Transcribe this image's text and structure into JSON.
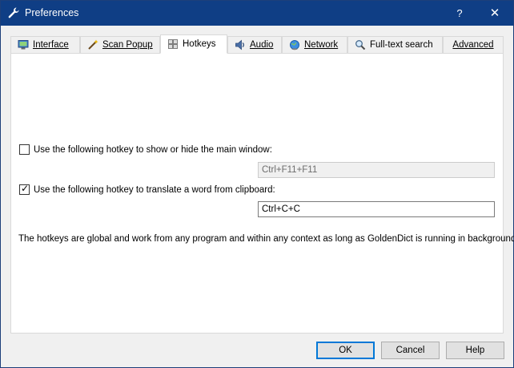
{
  "window": {
    "title": "Preferences",
    "help_symbol": "?",
    "close_symbol": "✕"
  },
  "tabs": [
    {
      "label": "Interface",
      "icon": "monitor-icon",
      "active": false
    },
    {
      "label": "Scan Popup",
      "icon": "wand-icon",
      "active": false
    },
    {
      "label": "Hotkeys",
      "icon": "keyboard-icon",
      "active": true
    },
    {
      "label": "Audio",
      "icon": "speaker-icon",
      "active": false
    },
    {
      "label": "Network",
      "icon": "globe-icon",
      "active": false
    },
    {
      "label": "Full-text search",
      "icon": "magnifier-icon",
      "active": false
    },
    {
      "label": "Advanced",
      "icon": "",
      "active": false
    }
  ],
  "hotkeys": {
    "main_window": {
      "label": "Use the following hotkey to show or hide the main window:",
      "checked": false,
      "value": "Ctrl+F11+F11",
      "enabled": false
    },
    "clipboard": {
      "label": "Use the following hotkey to translate a word from clipboard:",
      "checked": true,
      "value": "Ctrl+C+C",
      "enabled": true
    },
    "info": "The hotkeys are global and work from any program and within any context as long as GoldenDict is running in background."
  },
  "buttons": {
    "ok": "OK",
    "cancel": "Cancel",
    "help": "Help"
  },
  "colors": {
    "titlebar": "#0f3e85",
    "default_button_border": "#0078d7"
  }
}
